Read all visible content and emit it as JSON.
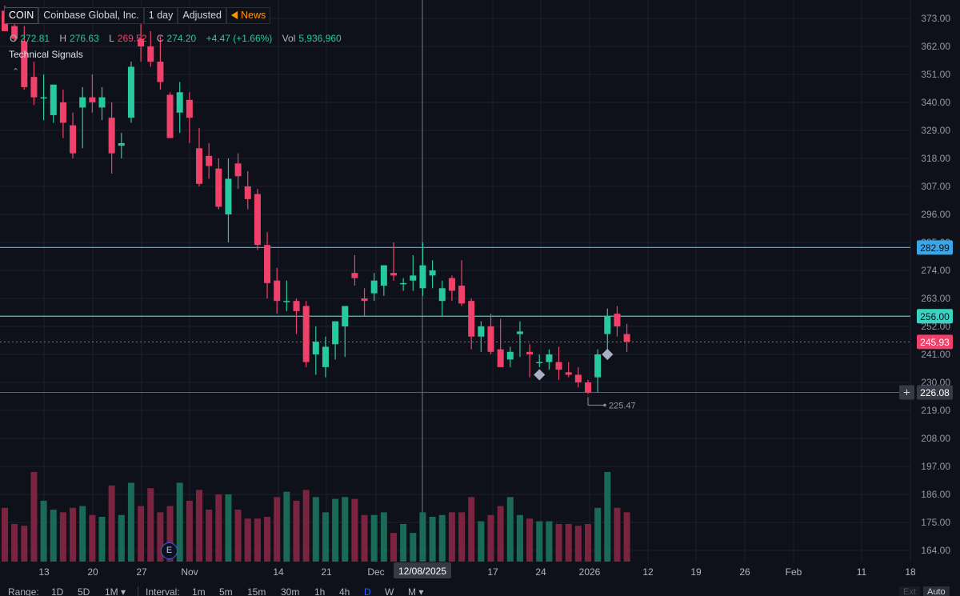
{
  "header": {
    "symbol": "COIN",
    "company": "Coinbase Global, Inc.",
    "interval": "1 day",
    "adjustment": "Adjusted",
    "news_label": "News",
    "open_label": "O",
    "open": "272.81",
    "high_label": "H",
    "high": "276.63",
    "low_label": "L",
    "low": "269.52",
    "close_label": "C",
    "close": "274.20",
    "change": "+4.47 (+1.66%)",
    "volume_label": "Vol",
    "volume": "5,936,960",
    "technical_signals": "Technical Signals",
    "collapse_glyph": "⌃"
  },
  "bottom_bar": {
    "range_label": "Range:",
    "ranges": [
      "1D",
      "5D",
      "1M ▾"
    ],
    "interval_label": "Interval:",
    "intervals": [
      "1m",
      "5m",
      "15m",
      "30m",
      "1h",
      "4h",
      "D",
      "W",
      "M ▾"
    ],
    "active_interval": "D",
    "ext_label": "Ext",
    "auto_label": "Auto"
  },
  "earnings_badge": "E",
  "colors": {
    "background": "#0f111a",
    "up": "#26c9a0",
    "down": "#f0416a",
    "up_volume": "#1a6a58",
    "down_volume": "#7a2440",
    "price_line_blue": "#3aa6e8",
    "price_line_teal": "#3ad2c0",
    "grid": "#1c2030",
    "crosshair": "#8a8fa0",
    "signal_marker": "#a8aec4"
  },
  "chart_data": {
    "type": "candlestick",
    "y_axis": {
      "ticks": [
        "373.00",
        "362.00",
        "351.00",
        "340.00",
        "329.00",
        "318.00",
        "307.00",
        "296.00",
        "285.00",
        "274.00",
        "263.00",
        "252.00",
        "241.00",
        "230.00",
        "219.00",
        "208.00",
        "197.00",
        "186.00",
        "175.00",
        "164.00"
      ],
      "range": [
        162,
        375
      ]
    },
    "x_axis": {
      "ticks": [
        {
          "label": "13",
          "date": "2025-10-13"
        },
        {
          "label": "20",
          "date": "2025-10-20"
        },
        {
          "label": "27",
          "date": "2025-10-27"
        },
        {
          "label": "Nov",
          "date": "2025-11-03"
        },
        {
          "label": "14",
          "date": "2025-11-14"
        },
        {
          "label": "21",
          "date": "2025-11-21"
        },
        {
          "label": "Dec",
          "date": "2025-12-01"
        },
        {
          "label": "17",
          "date": "2025-12-17"
        },
        {
          "label": "24",
          "date": "2025-12-24"
        },
        {
          "label": "2026",
          "date": "2026-01-01"
        },
        {
          "label": "12",
          "date": "2026-01-12"
        },
        {
          "label": "19",
          "date": "2026-01-20"
        },
        {
          "label": "26",
          "date": "2026-01-26"
        },
        {
          "label": "Feb",
          "date": "2026-02-02"
        },
        {
          "label": "11",
          "date": "2026-02-11"
        },
        {
          "label": "18",
          "date": "2026-02-18"
        }
      ],
      "crosshair_label": "12/08/2025"
    },
    "price_lines": [
      {
        "value": "282.99",
        "style": "blue"
      },
      {
        "value": "256.00",
        "style": "teal"
      },
      {
        "value": "245.93",
        "style": "last-price"
      },
      {
        "value": "226.08",
        "style": "crosshair"
      }
    ],
    "low_annotation": "225.47",
    "volume_range_max": 100,
    "candles": [
      {
        "o": 376,
        "h": 378,
        "l": 368,
        "c": 368,
        "v": 60
      },
      {
        "o": 370,
        "h": 374,
        "l": 364,
        "c": 365,
        "v": 42
      },
      {
        "o": 364,
        "h": 370,
        "l": 345,
        "c": 346,
        "v": 40
      },
      {
        "o": 350,
        "h": 356,
        "l": 339,
        "c": 342,
        "v": 100
      },
      {
        "o": 342,
        "h": 351,
        "l": 333,
        "c": 342,
        "v": 68
      },
      {
        "o": 335,
        "h": 346,
        "l": 332,
        "c": 347,
        "v": 58
      },
      {
        "o": 340,
        "h": 345,
        "l": 326,
        "c": 332,
        "v": 55
      },
      {
        "o": 331,
        "h": 336,
        "l": 318,
        "c": 320,
        "v": 60
      },
      {
        "o": 338,
        "h": 346,
        "l": 322,
        "c": 342,
        "v": 62
      },
      {
        "o": 342,
        "h": 351,
        "l": 336,
        "c": 340,
        "v": 52
      },
      {
        "o": 338,
        "h": 346,
        "l": 333,
        "c": 342,
        "v": 50
      },
      {
        "o": 334,
        "h": 340,
        "l": 312,
        "c": 320,
        "v": 85
      },
      {
        "o": 323,
        "h": 328,
        "l": 318,
        "c": 324,
        "v": 52
      },
      {
        "o": 334,
        "h": 356,
        "l": 332,
        "c": 354,
        "v": 88
      },
      {
        "o": 365,
        "h": 372,
        "l": 356,
        "c": 362,
        "v": 62
      },
      {
        "o": 362,
        "h": 368,
        "l": 354,
        "c": 356,
        "v": 82
      },
      {
        "o": 356,
        "h": 366,
        "l": 345,
        "c": 348,
        "v": 55
      },
      {
        "o": 343,
        "h": 344,
        "l": 326,
        "c": 326,
        "v": 62
      },
      {
        "o": 336,
        "h": 348,
        "l": 328,
        "c": 344,
        "v": 88
      },
      {
        "o": 341,
        "h": 344,
        "l": 324,
        "c": 334,
        "v": 68
      },
      {
        "o": 322,
        "h": 330,
        "l": 307,
        "c": 308,
        "v": 80
      },
      {
        "o": 319,
        "h": 324,
        "l": 310,
        "c": 315,
        "v": 58
      },
      {
        "o": 314,
        "h": 318,
        "l": 298,
        "c": 299,
        "v": 75
      },
      {
        "o": 296,
        "h": 318,
        "l": 285,
        "c": 310,
        "v": 75
      },
      {
        "o": 316,
        "h": 320,
        "l": 306,
        "c": 311,
        "v": 58
      },
      {
        "o": 307,
        "h": 313,
        "l": 298,
        "c": 302,
        "v": 48
      },
      {
        "o": 304,
        "h": 306,
        "l": 282,
        "c": 284,
        "v": 48
      },
      {
        "o": 284,
        "h": 289,
        "l": 263,
        "c": 269,
        "v": 50
      },
      {
        "o": 270,
        "h": 275,
        "l": 257,
        "c": 262,
        "v": 72
      },
      {
        "o": 262,
        "h": 270,
        "l": 258,
        "c": 262,
        "v": 78
      },
      {
        "o": 262,
        "h": 263,
        "l": 249,
        "c": 258,
        "v": 68
      },
      {
        "o": 260,
        "h": 262,
        "l": 236,
        "c": 238,
        "v": 80
      },
      {
        "o": 241,
        "h": 252,
        "l": 233,
        "c": 246,
        "v": 72
      },
      {
        "o": 236,
        "h": 248,
        "l": 232,
        "c": 244,
        "v": 55
      },
      {
        "o": 245,
        "h": 254,
        "l": 239,
        "c": 254,
        "v": 70
      },
      {
        "o": 252,
        "h": 259,
        "l": 240,
        "c": 260,
        "v": 72
      },
      {
        "o": 273,
        "h": 280,
        "l": 268,
        "c": 271,
        "v": 70
      },
      {
        "o": 263,
        "h": 267,
        "l": 256,
        "c": 262,
        "v": 52
      },
      {
        "o": 265,
        "h": 273,
        "l": 262,
        "c": 270,
        "v": 52
      },
      {
        "o": 268,
        "h": 276,
        "l": 264,
        "c": 276,
        "v": 55
      },
      {
        "o": 273,
        "h": 285,
        "l": 270,
        "c": 272,
        "v": 32
      },
      {
        "o": 269,
        "h": 271,
        "l": 266,
        "c": 269,
        "v": 42
      },
      {
        "o": 270,
        "h": 280,
        "l": 266,
        "c": 272,
        "v": 32
      },
      {
        "o": 267,
        "h": 285,
        "l": 264,
        "c": 276,
        "v": 55
      },
      {
        "o": 272,
        "h": 278,
        "l": 267,
        "c": 274,
        "v": 50
      },
      {
        "o": 262,
        "h": 270,
        "l": 256,
        "c": 267,
        "v": 52
      },
      {
        "o": 271,
        "h": 272,
        "l": 262,
        "c": 266,
        "v": 55
      },
      {
        "o": 268,
        "h": 278,
        "l": 260,
        "c": 261,
        "v": 55
      },
      {
        "o": 262,
        "h": 263,
        "l": 243,
        "c": 248,
        "v": 72
      },
      {
        "o": 248,
        "h": 254,
        "l": 242,
        "c": 252,
        "v": 45
      },
      {
        "o": 252,
        "h": 257,
        "l": 241,
        "c": 242,
        "v": 52
      },
      {
        "o": 243,
        "h": 255,
        "l": 237,
        "c": 236,
        "v": 62
      },
      {
        "o": 239,
        "h": 244,
        "l": 236,
        "c": 242,
        "v": 72
      },
      {
        "o": 249,
        "h": 254,
        "l": 240,
        "c": 250,
        "v": 52
      },
      {
        "o": 242,
        "h": 245,
        "l": 232,
        "c": 241,
        "v": 48
      },
      {
        "o": 238,
        "h": 241,
        "l": 236,
        "c": 238,
        "v": 45
      },
      {
        "o": 238,
        "h": 243,
        "l": 235,
        "c": 241,
        "v": 45
      },
      {
        "o": 238,
        "h": 244,
        "l": 231,
        "c": 235,
        "v": 42
      },
      {
        "o": 234,
        "h": 238,
        "l": 232,
        "c": 233,
        "v": 42
      },
      {
        "o": 233,
        "h": 236,
        "l": 228,
        "c": 230,
        "v": 40
      },
      {
        "o": 230,
        "h": 231,
        "l": 225.47,
        "c": 226,
        "v": 42
      },
      {
        "o": 232,
        "h": 243,
        "l": 226,
        "c": 241,
        "v": 60
      },
      {
        "o": 249,
        "h": 259,
        "l": 243,
        "c": 256,
        "v": 100
      },
      {
        "o": 257,
        "h": 260,
        "l": 248,
        "c": 252,
        "v": 60
      },
      {
        "o": 249,
        "h": 253,
        "l": 242,
        "c": 246,
        "v": 55
      }
    ],
    "signal_markers": [
      {
        "index": 55,
        "value": 233
      },
      {
        "index": 62,
        "value": 241
      }
    ]
  }
}
